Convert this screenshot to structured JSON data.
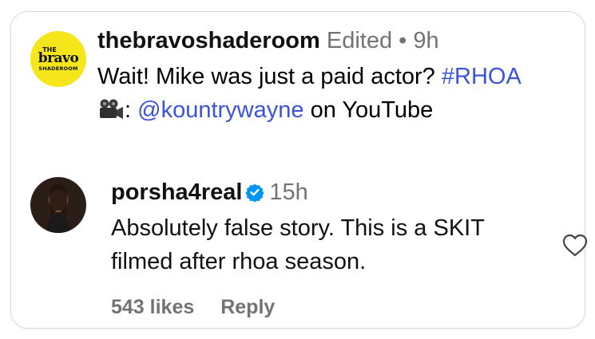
{
  "post": {
    "username": "thebravoshaderoom",
    "edited": "Edited",
    "separator": "•",
    "time": "9h",
    "line1": "Wait! Mike was just a paid actor?",
    "hashtag": "#RHOA",
    "colon": ":",
    "mention": "@kountrywayne",
    "suffix": "on YouTube",
    "logo_lines": [
      "THE",
      "bravo",
      "SHADEROOM"
    ]
  },
  "comment": {
    "username": "porsha4real",
    "time": "15h",
    "text": "Absolutely false story. This is a SKIT filmed after rhoa season.",
    "likes": "543 likes",
    "reply": "Reply"
  },
  "icons": {
    "camera": "movie-camera-icon",
    "verified": "verified-badge-icon",
    "heart": "heart-outline-icon"
  },
  "colors": {
    "link": "#3b53d9",
    "verified": "#0095f6",
    "muted": "#737373",
    "logo_bg": "#f4e61b"
  }
}
